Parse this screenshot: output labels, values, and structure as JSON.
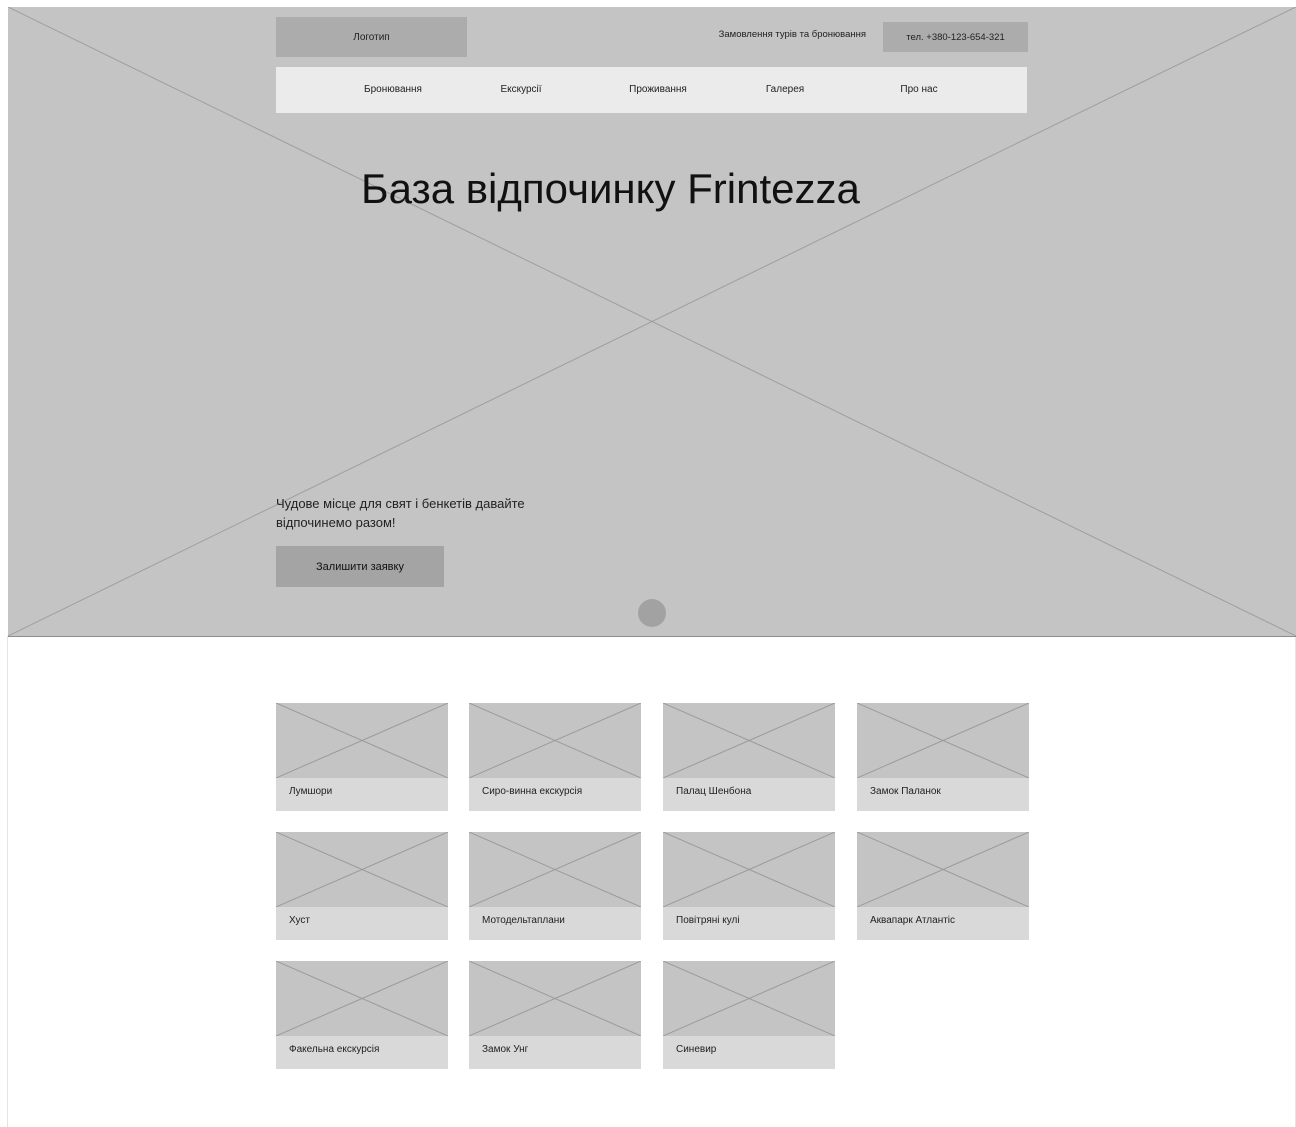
{
  "header": {
    "logo_label": "Логотип",
    "booking_text": "Замовлення турів та бронювання",
    "phone_label": "тел. +380-123-654-321"
  },
  "nav": {
    "items": [
      {
        "label": "Бронювання"
      },
      {
        "label": "Екскурсії"
      },
      {
        "label": "Проживання"
      },
      {
        "label": "Галерея"
      },
      {
        "label": "Про нас"
      }
    ]
  },
  "hero": {
    "title": "База відпочинку Frintezza",
    "subtitle": "Чудове місце для свят і бенкетів  давайте відпочинемо разом!",
    "cta_label": "Залишити заявку"
  },
  "tours": {
    "cards": [
      {
        "label": "Лумшори"
      },
      {
        "label": "Сиро-винна екскурсія"
      },
      {
        "label": "Палац Шенбона"
      },
      {
        "label": "Замок Паланок"
      },
      {
        "label": "Хуст"
      },
      {
        "label": "Мотодельтаплани"
      },
      {
        "label": "Повітряні кулі"
      },
      {
        "label": "Аквапарк Атлантіс"
      },
      {
        "label": "Факельна екскурсія"
      },
      {
        "label": "Замок Унг"
      },
      {
        "label": "Синевир"
      }
    ]
  },
  "colors": {
    "hero_bg": "#c4c4c4",
    "placeholder_dark": "#acacac",
    "nav_bg": "#ebebeb",
    "card_caption_bg": "#d9d9d9"
  }
}
